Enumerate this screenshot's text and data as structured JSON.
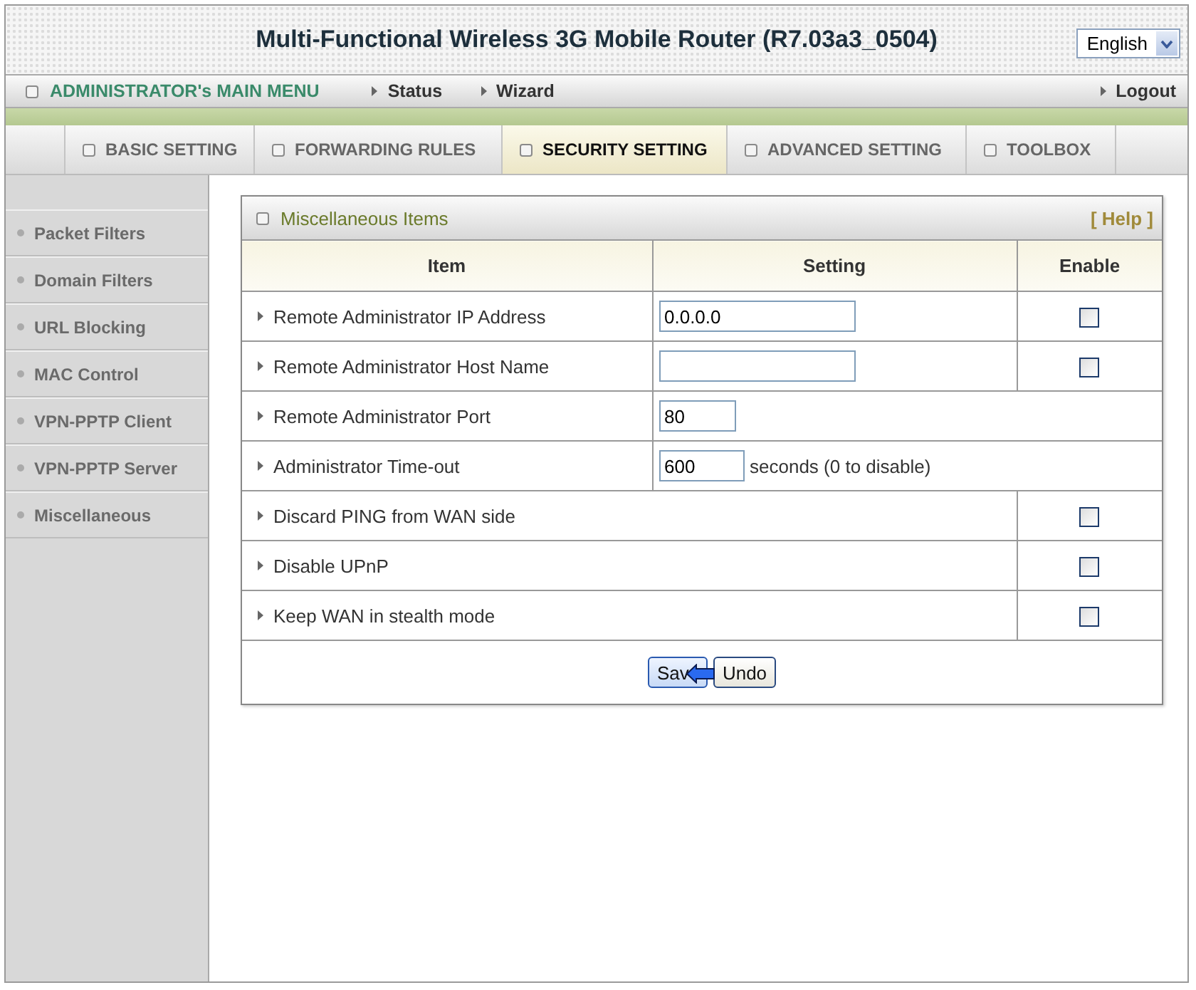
{
  "header": {
    "title": "Multi-Functional Wireless 3G Mobile Router (R7.03a3_0504)",
    "language": "English"
  },
  "main_menu": {
    "title": "ADMINISTRATOR's MAIN MENU",
    "links": [
      "Status",
      "Wizard"
    ],
    "logout": "Logout"
  },
  "tabs": [
    {
      "label": "BASIC SETTING",
      "selected": false
    },
    {
      "label": "FORWARDING RULES",
      "selected": false
    },
    {
      "label": "SECURITY SETTING",
      "selected": true
    },
    {
      "label": "ADVANCED SETTING",
      "selected": false
    },
    {
      "label": "TOOLBOX",
      "selected": false
    }
  ],
  "sidebar": {
    "items": [
      "Packet Filters",
      "Domain Filters",
      "URL Blocking",
      "MAC Control",
      "VPN-PPTP Client",
      "VPN-PPTP Server",
      "Miscellaneous"
    ]
  },
  "panel": {
    "title": "Miscellaneous Items",
    "help": "[ Help ]",
    "columns": [
      "Item",
      "Setting",
      "Enable"
    ],
    "rows": [
      {
        "kind": "text_check",
        "label": "Remote Administrator IP Address",
        "value": "0.0.0.0",
        "checked": false
      },
      {
        "kind": "text_check",
        "label": "Remote Administrator Host Name",
        "checked": false
      },
      {
        "kind": "text",
        "label": "Remote Administrator Port",
        "value": "80"
      },
      {
        "kind": "text",
        "label": "Administrator Time-out",
        "value": "600",
        "note": "seconds (0 to disable)"
      },
      {
        "kind": "check",
        "label": "Discard PING from WAN side",
        "checked": false
      },
      {
        "kind": "check",
        "label": "Disable UPnP",
        "checked": false
      },
      {
        "kind": "check",
        "label": "Keep WAN in stealth mode",
        "checked": false
      }
    ],
    "buttons": [
      "Sav",
      "Undo"
    ]
  }
}
